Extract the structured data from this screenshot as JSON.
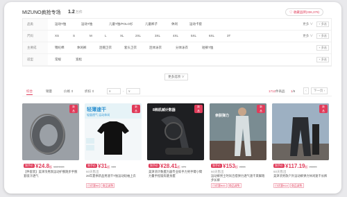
{
  "header": {
    "title": "MIZUNO疯抢专场",
    "count_number": "1.2",
    "count_unit": "万件",
    "favorite": "♡ 收藏品牌(336,379)"
  },
  "filters": [
    {
      "label": "品类",
      "options": [
        "运动T恤",
        "运动T恤",
        "儿童T恤/POLO衫",
        "儿童裤子",
        "休闲",
        "运动卡套"
      ],
      "more": "更多 ∨",
      "multi": "+ 多选"
    },
    {
      "label": "尺码",
      "options": [
        "XS",
        "S",
        "M",
        "L",
        "XL",
        "2XL",
        "3XL",
        "4XL",
        "5XL",
        "6XL",
        "3T"
      ],
      "more": "更多 ∨",
      "multi": "+ 多选"
    },
    {
      "label": "主要成",
      "options": [
        "锦纶棉",
        "休闲裤",
        "连帽卫衣",
        "套头卫衣",
        "连体泳衣",
        "分体泳衣",
        "短裤T恤"
      ],
      "more": "",
      "multi": "+ 多选"
    },
    {
      "label": "适型",
      "options": [
        "常规",
        "宽松"
      ],
      "more": "",
      "multi": "+ 多选"
    }
  ],
  "expand_label": "更多选项 ∨",
  "sortbar": {
    "tabs": [
      "综合",
      "销量",
      "价格 ⇕",
      "折扣 ⇕"
    ],
    "price_from": "¥",
    "price_sep": "-",
    "price_to": "¥",
    "total_number": "1712",
    "total_suffix": "件商品",
    "page_current": "1",
    "page_total": "/9",
    "prev": "‹",
    "next_label": "下一页 ›"
  },
  "products": [
    {
      "badge": "到手价",
      "price": "¥24.8",
      "suffix": "起",
      "orig": "¥62.3.69",
      "sales": "",
      "title": "【件套装】美津浓男款运动护腕跑步手腕套吸汗透气",
      "tags": []
    },
    {
      "badge": "到手价",
      "price": "¥31",
      "suffix": "起",
      "orig": "¥69",
      "sales": "60天售出",
      "title": "26年夏季新品男速干T恤运动短袖上衣",
      "tags": [
        "已优惠¥8",
        "商品减免"
      ],
      "overlay": ""
    },
    {
      "badge": "到手价",
      "price": "¥28.41",
      "suffix": "起",
      "orig": "¥79",
      "sales": "",
      "title": "美津浓计数握力器专业练手力男手臂小臂力量手指锻炼健身握",
      "tags": [],
      "overlay": "8档机械计数器"
    },
    {
      "badge": "到手价",
      "price": "¥153",
      "suffix": "起",
      "orig": "¥355",
      "sales": "60天售出",
      "title": "运动裤男士时尚百搭弹力透气速干束脚跑步长裤",
      "tags": [
        "已优惠¥45",
        "商品减免"
      ],
      "overlay": "亲肤弹力"
    },
    {
      "badge": "到手价",
      "price": "¥117.19",
      "suffix": "起",
      "orig": "¥1099",
      "sales": "60天售出",
      "title": "美津浓男款户外运动裤弹力休闲速干长裤",
      "tags": [
        "已优惠¥18",
        "商品减免"
      ],
      "overlay": ""
    }
  ],
  "overlay_texts": {
    "p1_top": "轻薄速干",
    "p1_sub": "轻量透气 运动休闲",
    "p3_top": "8档机械计数器",
    "p4_top": "亲肤弹力"
  },
  "colors": {
    "accent": "#e03c5a"
  }
}
